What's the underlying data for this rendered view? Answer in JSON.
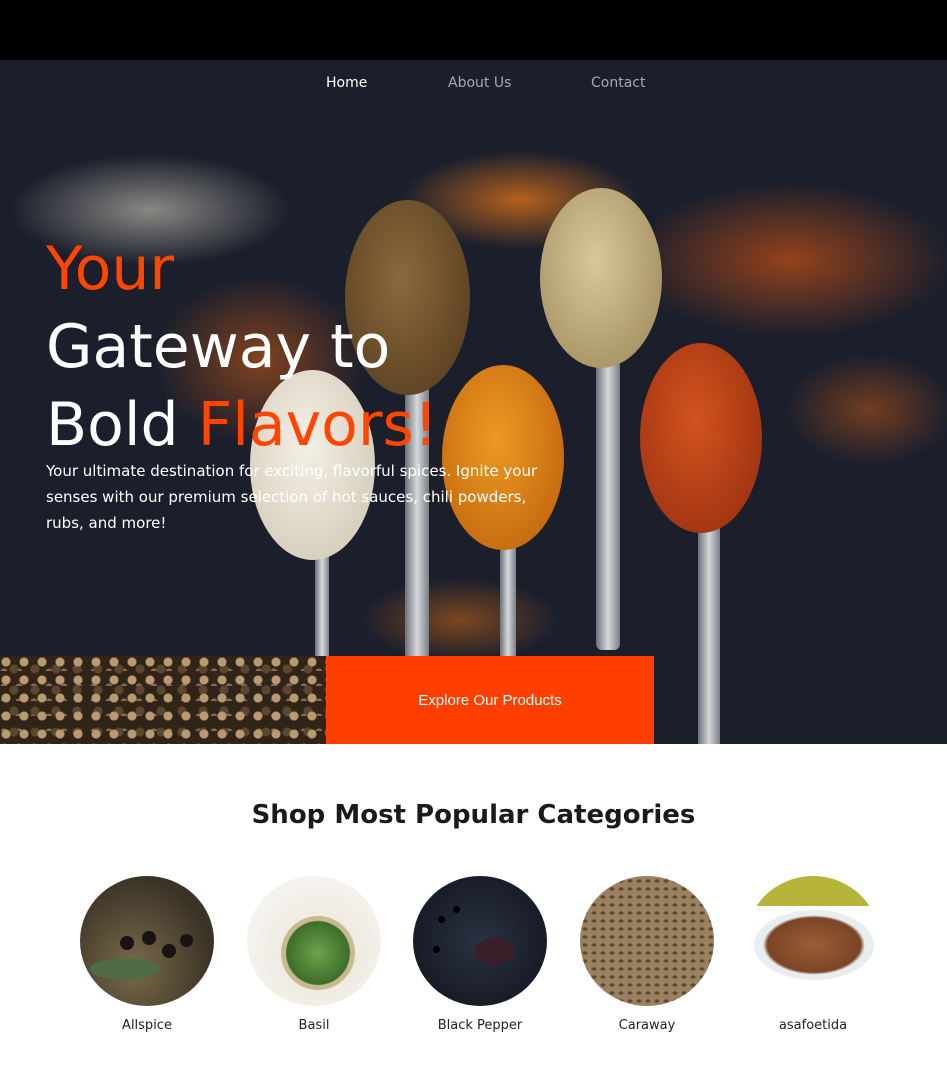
{
  "nav": {
    "items": [
      {
        "label": "Home",
        "active": true
      },
      {
        "label": "About Us",
        "active": false
      },
      {
        "label": "Contact",
        "active": false
      }
    ]
  },
  "hero": {
    "title_line1": "Your",
    "title_line2": "Gateway to",
    "title_line3_plain": "Bold ",
    "title_line3_accent": "Flavors!",
    "description": "Your ultimate destination for exciting, flavorful spices. Ignite your senses with our premium selection of hot sauces, chili powders, rubs, and more!",
    "cta_label": "Explore Our Products"
  },
  "categories": {
    "title": "Shop Most Popular Categories",
    "items": [
      {
        "label": "Allspice"
      },
      {
        "label": "Basil"
      },
      {
        "label": "Black Pepper"
      },
      {
        "label": "Caraway"
      },
      {
        "label": "asafoetida"
      }
    ]
  },
  "colors": {
    "accent": "#ff4500",
    "button": "#ff3f00",
    "top_bar": "#000000"
  }
}
